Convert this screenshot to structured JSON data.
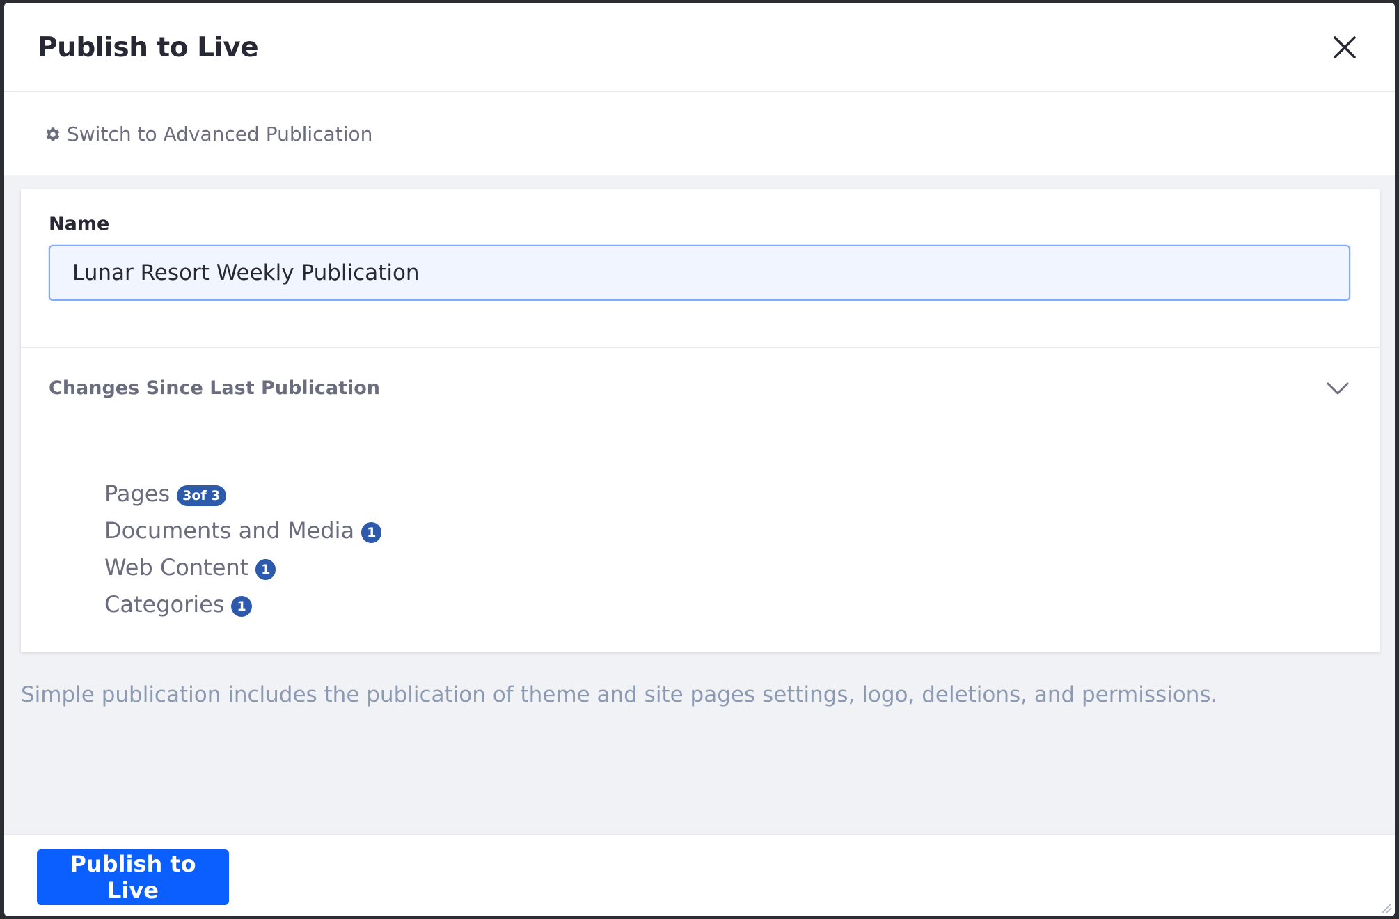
{
  "modal": {
    "title": "Publish to Live",
    "close_icon": "close-icon"
  },
  "toolbar": {
    "advanced_link_label": "Switch to Advanced Publication",
    "advanced_icon": "gear-icon"
  },
  "form": {
    "name_label": "Name",
    "name_value": "Lunar Resort Weekly Publication"
  },
  "changes": {
    "title": "Changes Since Last Publication",
    "toggle_icon": "chevron-down-icon",
    "items": [
      {
        "label": "Pages",
        "badge": "3of 3"
      },
      {
        "label": "Documents and Media",
        "badge": "1"
      },
      {
        "label": "Web Content",
        "badge": "1"
      },
      {
        "label": "Categories",
        "badge": "1"
      }
    ]
  },
  "note": "Simple publication includes the publication of theme and site pages settings, logo, deletions, and permissions.",
  "footer": {
    "publish_label": "Publish to Live"
  },
  "colors": {
    "primary": "#0b5fff",
    "badge": "#2e5aac",
    "body_bg": "#f1f2f5",
    "muted_text": "#6b6c7e",
    "note_text": "#8b9ab2"
  }
}
